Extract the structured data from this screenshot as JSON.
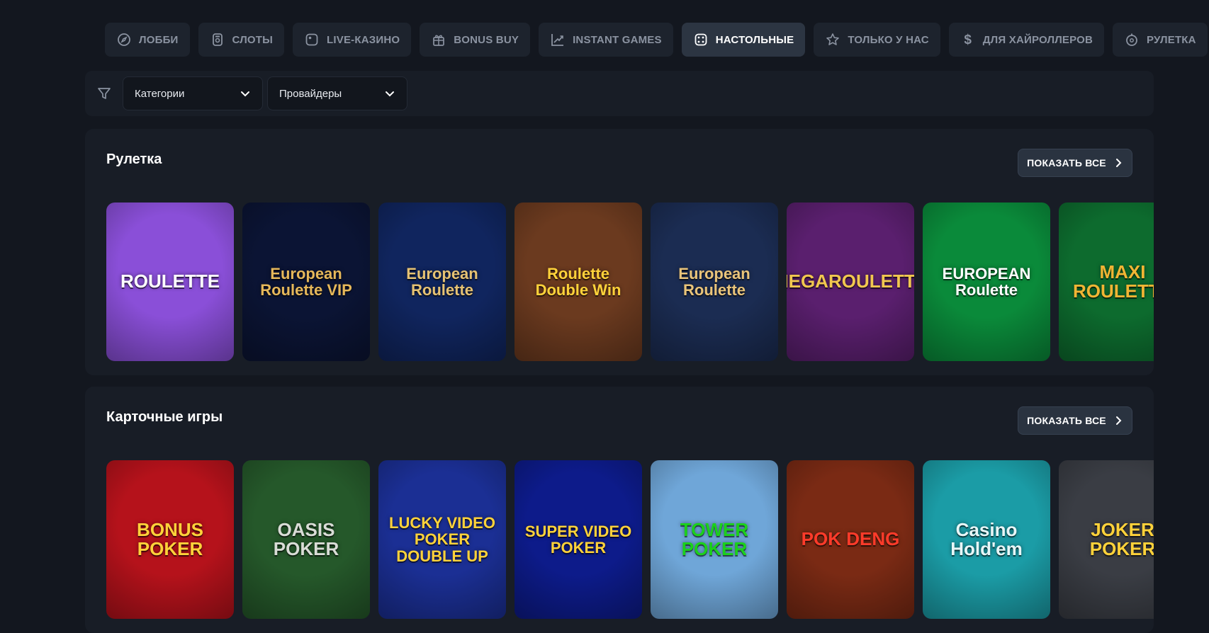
{
  "nav": {
    "tabs": [
      {
        "label": "ЛОББИ",
        "icon": "compass-icon"
      },
      {
        "label": "СЛОТЫ",
        "icon": "slot-icon"
      },
      {
        "label": "LIVE-КАЗИНО",
        "icon": "live-icon"
      },
      {
        "label": "BONUS BUY",
        "icon": "gift-icon"
      },
      {
        "label": "INSTANT GAMES",
        "icon": "chart-up-icon"
      },
      {
        "label": "НАСТОЛЬНЫЕ",
        "icon": "dice-icon",
        "active": true
      },
      {
        "label": "ТОЛЬКО У НАС",
        "icon": "star-icon"
      },
      {
        "label": "ДЛЯ ХАЙРОЛЛЕРОВ",
        "icon": "dollar-icon"
      },
      {
        "label": "РУЛЕТКА",
        "icon": "roulette-icon"
      }
    ],
    "dollar_glyph": "$"
  },
  "filters": {
    "categories_label": "Категории",
    "providers_label": "Провайдеры"
  },
  "sections": [
    {
      "title": "Рулетка",
      "show_all": "ПОКАЗАТЬ ВСЕ",
      "games": [
        {
          "title": "ROULETTE",
          "bg": "#8a4fd8",
          "color": "#ffffff"
        },
        {
          "title": "European Roulette VIP",
          "bg": "#0b1434",
          "color": "#e6b85a"
        },
        {
          "title": "European Roulette",
          "bg": "#10255e",
          "color": "#e6c273"
        },
        {
          "title": "Roulette Double Win",
          "bg": "#6b3a1f",
          "color": "#ffd23a"
        },
        {
          "title": "European Roulette",
          "bg": "#1b2c52",
          "color": "#e9c47a"
        },
        {
          "title": "MEGAROULETTE",
          "bg": "#5a1f6e",
          "color": "#f1c74f"
        },
        {
          "title": "EUROPEAN Roulette",
          "bg": "#0a8a3a",
          "color": "#ffffff"
        },
        {
          "title": "MAXI ROULETTE",
          "bg": "#0d6b2e",
          "color": "#f1b534"
        }
      ]
    },
    {
      "title": "Карточные игры",
      "show_all": "ПОКАЗАТЬ ВСЕ",
      "games": [
        {
          "title": "BONUS POKER",
          "bg": "#b5121b",
          "color": "#ffd23a"
        },
        {
          "title": "OASIS POKER",
          "bg": "#25582a",
          "color": "#d9dcd6"
        },
        {
          "title": "LUCKY VIDEO POKER DOUBLE UP",
          "bg": "#1b2f94",
          "color": "#ffd23a"
        },
        {
          "title": "SUPER VIDEO POKER",
          "bg": "#0d1b8a",
          "color": "#ffd23a"
        },
        {
          "title": "TOWER POKER",
          "bg": "#6fa6d8",
          "color": "#1bd11b"
        },
        {
          "title": "POK DENG",
          "bg": "#7a2a14",
          "color": "#ff3b2a"
        },
        {
          "title": "Casino Hold'em",
          "bg": "#1b9ca6",
          "color": "#e7f6f7"
        },
        {
          "title": "JOKER POKER",
          "bg": "#3a3d44",
          "color": "#ffd23a"
        }
      ]
    }
  ]
}
